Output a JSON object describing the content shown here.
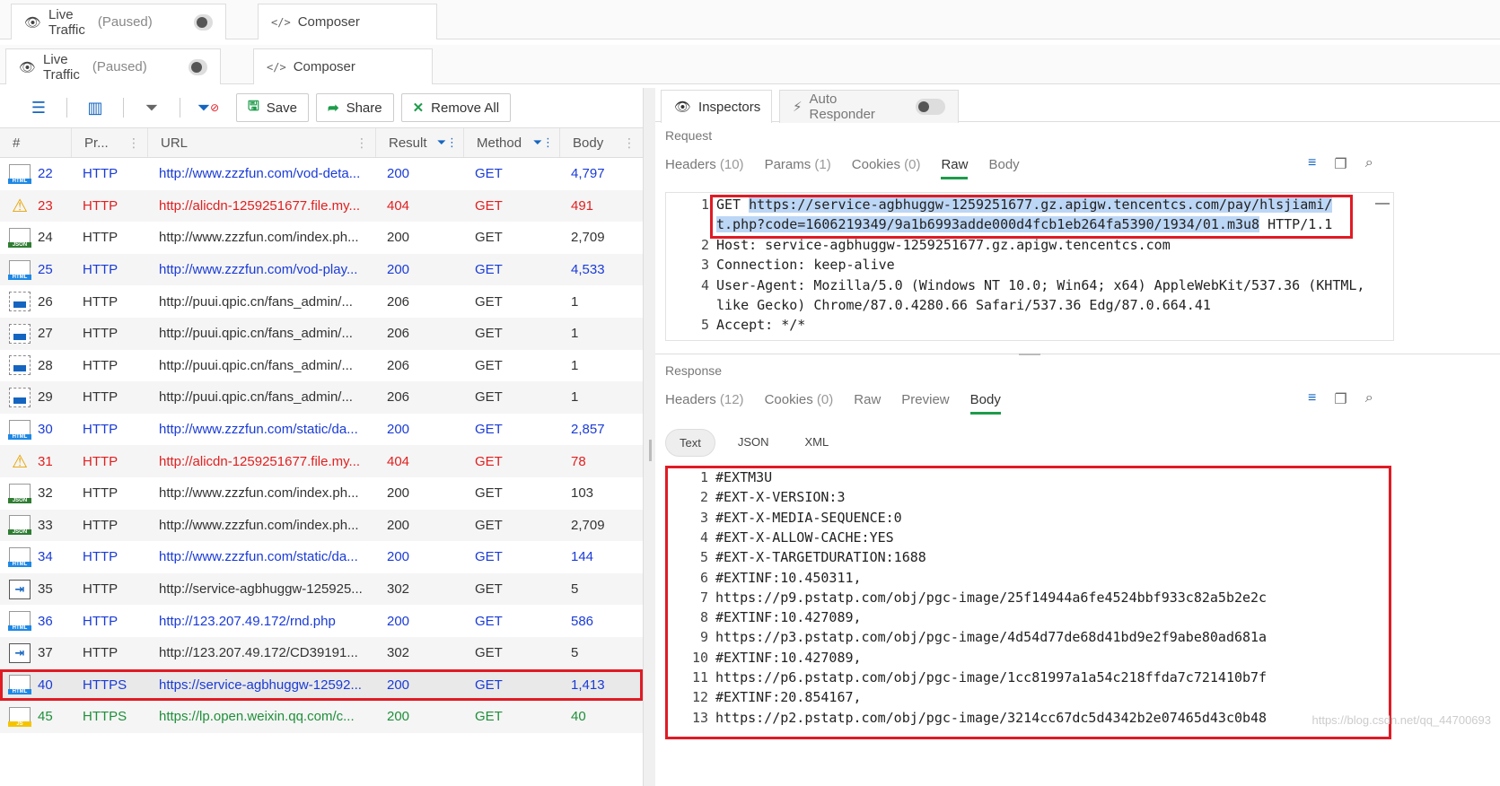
{
  "ghost_tabs": {
    "live": {
      "label": "Live Traffic",
      "status": "(Paused)"
    },
    "composer": {
      "label": "Composer"
    }
  },
  "tabs": {
    "live": {
      "label": "Live Traffic",
      "status": "(Paused)"
    },
    "composer": {
      "label": "Composer"
    }
  },
  "toolbar": {
    "save": "Save",
    "share": "Share",
    "remove_all": "Remove All"
  },
  "grid": {
    "headers": {
      "id": "#",
      "protocol": "Pr...",
      "url": "URL",
      "result": "Result",
      "method": "Method",
      "body": "Body"
    },
    "rows": [
      {
        "id": "22",
        "icon": "html-icon",
        "color": "blue",
        "protocol": "HTTP",
        "url": "http://www.zzzfun.com/vod-deta...",
        "result": "200",
        "method": "GET",
        "body": "4,797"
      },
      {
        "id": "23",
        "icon": "warning-icon",
        "color": "red",
        "protocol": "HTTP",
        "url": "http://alicdn-1259251677.file.my...",
        "result": "404",
        "method": "GET",
        "body": "491"
      },
      {
        "id": "24",
        "icon": "json-icon",
        "color": "normal",
        "protocol": "HTTP",
        "url": "http://www.zzzfun.com/index.ph...",
        "result": "200",
        "method": "GET",
        "body": "2,709"
      },
      {
        "id": "25",
        "icon": "html-icon",
        "color": "blue",
        "protocol": "HTTP",
        "url": "http://www.zzzfun.com/vod-play...",
        "result": "200",
        "method": "GET",
        "body": "4,533"
      },
      {
        "id": "26",
        "icon": "image-icon",
        "color": "normal",
        "protocol": "HTTP",
        "url": "http://puui.qpic.cn/fans_admin/...",
        "result": "206",
        "method": "GET",
        "body": "1"
      },
      {
        "id": "27",
        "icon": "image-icon",
        "color": "normal",
        "protocol": "HTTP",
        "url": "http://puui.qpic.cn/fans_admin/...",
        "result": "206",
        "method": "GET",
        "body": "1"
      },
      {
        "id": "28",
        "icon": "image-icon",
        "color": "normal",
        "protocol": "HTTP",
        "url": "http://puui.qpic.cn/fans_admin/...",
        "result": "206",
        "method": "GET",
        "body": "1"
      },
      {
        "id": "29",
        "icon": "image-icon",
        "color": "normal",
        "protocol": "HTTP",
        "url": "http://puui.qpic.cn/fans_admin/...",
        "result": "206",
        "method": "GET",
        "body": "1"
      },
      {
        "id": "30",
        "icon": "html-icon",
        "color": "blue",
        "protocol": "HTTP",
        "url": "http://www.zzzfun.com/static/da...",
        "result": "200",
        "method": "GET",
        "body": "2,857"
      },
      {
        "id": "31",
        "icon": "warning-icon",
        "color": "red",
        "protocol": "HTTP",
        "url": "http://alicdn-1259251677.file.my...",
        "result": "404",
        "method": "GET",
        "body": "78"
      },
      {
        "id": "32",
        "icon": "json-icon",
        "color": "normal",
        "protocol": "HTTP",
        "url": "http://www.zzzfun.com/index.ph...",
        "result": "200",
        "method": "GET",
        "body": "103"
      },
      {
        "id": "33",
        "icon": "json-icon",
        "color": "normal",
        "protocol": "HTTP",
        "url": "http://www.zzzfun.com/index.ph...",
        "result": "200",
        "method": "GET",
        "body": "2,709"
      },
      {
        "id": "34",
        "icon": "html-icon",
        "color": "blue",
        "protocol": "HTTP",
        "url": "http://www.zzzfun.com/static/da...",
        "result": "200",
        "method": "GET",
        "body": "144"
      },
      {
        "id": "35",
        "icon": "redirect-icon",
        "color": "normal",
        "protocol": "HTTP",
        "url": "http://service-agbhuggw-125925...",
        "result": "302",
        "method": "GET",
        "body": "5"
      },
      {
        "id": "36",
        "icon": "html-icon",
        "color": "blue",
        "protocol": "HTTP",
        "url": "http://123.207.49.172/rnd.php",
        "result": "200",
        "method": "GET",
        "body": "586"
      },
      {
        "id": "37",
        "icon": "redirect-icon",
        "color": "normal",
        "protocol": "HTTP",
        "url": "http://123.207.49.172/CD39191...",
        "result": "302",
        "method": "GET",
        "body": "5"
      },
      {
        "id": "40",
        "icon": "html-icon",
        "color": "blue",
        "selected": true,
        "protocol": "HTTPS",
        "url": "https://service-agbhuggw-12592...",
        "result": "200",
        "method": "GET",
        "body": "1,413"
      },
      {
        "id": "45",
        "icon": "js-icon",
        "color": "green",
        "protocol": "HTTPS",
        "url": "https://lp.open.weixin.qq.com/c...",
        "result": "200",
        "method": "GET",
        "body": "40"
      }
    ]
  },
  "right_tabs": {
    "inspectors": "Inspectors",
    "auto_responder": "Auto Responder"
  },
  "request": {
    "label": "Request",
    "tabs": [
      {
        "label": "Headers",
        "count": "(10)"
      },
      {
        "label": "Params",
        "count": "(1)"
      },
      {
        "label": "Cookies",
        "count": "(0)"
      },
      {
        "label": "Raw",
        "count": ""
      },
      {
        "label": "Body",
        "count": ""
      }
    ],
    "active_tab": "Raw",
    "lines": [
      {
        "n": "1",
        "pre": "GET ",
        "hl": "https://service-agbhuggw-1259251677.gz.apigw.tencentcs.com/pay/hlsjiami/"
      },
      {
        "n": "",
        "pre": "",
        "hl": "t.php?code=1606219349/9a1b6993adde000d4fcb1eb264fa5390/1934/01.m3u8",
        "post": " HTTP/1.1"
      },
      {
        "n": "2",
        "pre": "Host: service-agbhuggw-1259251677.gz.apigw.tencentcs.com"
      },
      {
        "n": "3",
        "pre": "Connection: keep-alive"
      },
      {
        "n": "4",
        "pre": "User-Agent: Mozilla/5.0 (Windows NT 10.0; Win64; x64) AppleWebKit/537.36 (KHTML,"
      },
      {
        "n": "",
        "pre": "like Gecko) Chrome/87.0.4280.66 Safari/537.36 Edg/87.0.664.41"
      },
      {
        "n": "5",
        "pre": "Accept: */*"
      }
    ]
  },
  "response": {
    "label": "Response",
    "tabs": [
      {
        "label": "Headers",
        "count": "(12)"
      },
      {
        "label": "Cookies",
        "count": "(0)"
      },
      {
        "label": "Raw",
        "count": ""
      },
      {
        "label": "Preview",
        "count": ""
      },
      {
        "label": "Body",
        "count": ""
      }
    ],
    "active_tab": "Body",
    "format_pills": [
      "Text",
      "JSON",
      "XML"
    ],
    "active_pill": "Text",
    "lines": [
      {
        "n": "1",
        "t": "#EXTM3U"
      },
      {
        "n": "2",
        "t": "#EXT-X-VERSION:3"
      },
      {
        "n": "3",
        "t": "#EXT-X-MEDIA-SEQUENCE:0"
      },
      {
        "n": "4",
        "t": "#EXT-X-ALLOW-CACHE:YES"
      },
      {
        "n": "5",
        "t": "#EXT-X-TARGETDURATION:1688"
      },
      {
        "n": "6",
        "t": "#EXTINF:10.450311,"
      },
      {
        "n": "7",
        "t": "https://p9.pstatp.com/obj/pgc-image/25f14944a6fe4524bbf933c82a5b2e2c"
      },
      {
        "n": "8",
        "t": "#EXTINF:10.427089,"
      },
      {
        "n": "9",
        "t": "https://p3.pstatp.com/obj/pgc-image/4d54d77de68d41bd9e2f9abe80ad681a"
      },
      {
        "n": "10",
        "t": "#EXTINF:10.427089,"
      },
      {
        "n": "11",
        "t": "https://p6.pstatp.com/obj/pgc-image/1cc81997a1a54c218ffda7c721410b7f"
      },
      {
        "n": "12",
        "t": "#EXTINF:20.854167,"
      },
      {
        "n": "13",
        "t": "https://p2.pstatp.com/obj/pgc-image/3214cc67dc5d4342b2e07465d43c0b48"
      }
    ]
  },
  "watermark": "https://blog.csdn.net/qq_44700693"
}
